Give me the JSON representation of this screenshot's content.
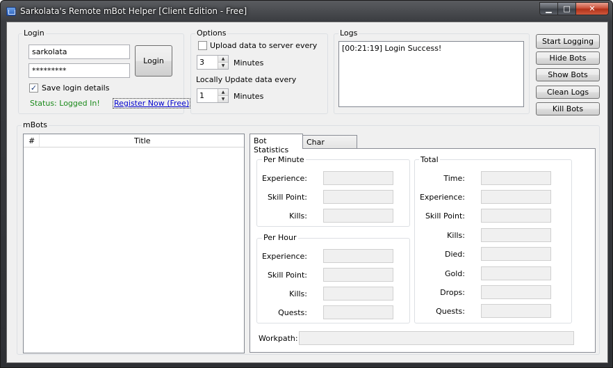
{
  "window": {
    "title": "Sarkolata's Remote mBot Helper [Client Edition - Free]"
  },
  "caption": {
    "min": "▁",
    "max": "□",
    "close": "✕"
  },
  "login": {
    "legend": "Login",
    "username": "sarkolata",
    "password": "*********",
    "login_button": "Login",
    "save_label": "Save login details",
    "save_checked": "✓",
    "status": "Status: Logged In!",
    "register_link": "Register Now (Free)",
    "status_color": "#1a8a1a",
    "link_color": "#0000cc"
  },
  "options": {
    "legend": "Options",
    "upload_label": "Upload data to server every",
    "upload_value": "3",
    "minutes1": "Minutes",
    "local_label": "Locally Update data every",
    "local_value": "1",
    "minutes2": "Minutes"
  },
  "logs": {
    "legend": "Logs",
    "entries": [
      "[00:21:19] Login Success!"
    ]
  },
  "actions": {
    "start_logging": "Start Logging",
    "hide_bots": "Hide Bots",
    "show_bots": "Show Bots",
    "clean_logs": "Clean Logs",
    "kill_bots": "Kill Bots"
  },
  "mbots": {
    "legend": "mBots",
    "columns": [
      "#",
      "Title"
    ]
  },
  "tabs": {
    "bot_statistics": "Bot Statistics",
    "char_statistics": "Char Statistics"
  },
  "per_minute": {
    "legend": "Per Minute",
    "labels": [
      "Experience:",
      "Skill Point:",
      "Kills:"
    ]
  },
  "per_hour": {
    "legend": "Per Hour",
    "labels": [
      "Experience:",
      "Skill Point:",
      "Kills:",
      "Quests:"
    ]
  },
  "total": {
    "legend": "Total",
    "labels": [
      "Time:",
      "Experience:",
      "Skill Point:",
      "Kills:",
      "Died:",
      "Gold:",
      "Drops:",
      "Quests:"
    ]
  },
  "workpath": {
    "label": "Workpath:"
  }
}
